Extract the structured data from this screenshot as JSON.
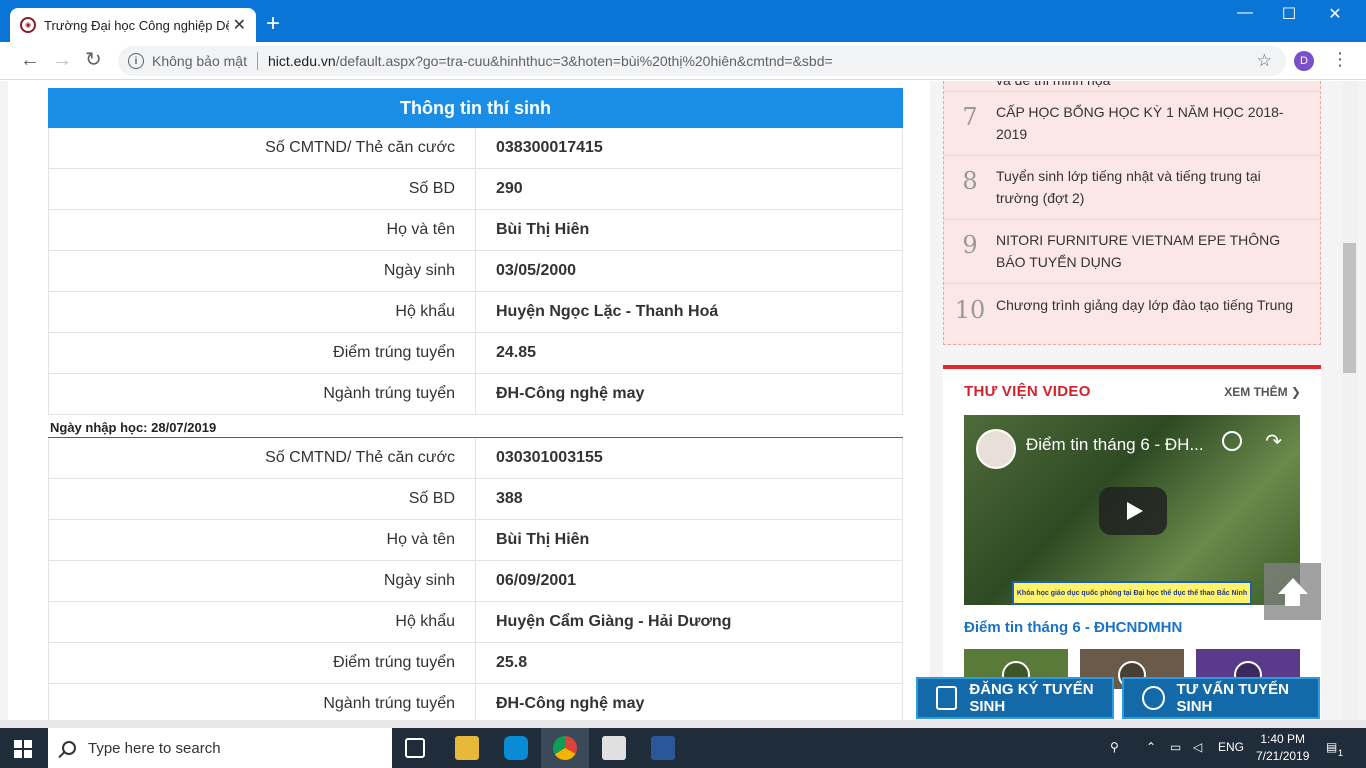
{
  "browser": {
    "tab_title": "Trường Đại học Công nghiệp Dệt",
    "tab_close": "✕",
    "new_tab": "+",
    "minimize": "—",
    "maximize": "☐",
    "close": "✕",
    "back": "←",
    "forward": "→",
    "reload": "↻",
    "security_text": "Không bảo mật",
    "url_host": "hict.edu.vn",
    "url_path": "/default.aspx?go=tra-cuu&hinhthuc=3&hoten=bùi%20thị%20hiên&cmtnd=&sbd=",
    "star": "☆",
    "avatar_letter": "D",
    "menu": "⋮"
  },
  "table": {
    "header": "Thông tin thí sinh",
    "records": [
      {
        "rows": [
          {
            "label": "Số CMTND/ Thẻ căn cước",
            "value": "038300017415"
          },
          {
            "label": "Số BD",
            "value": "290"
          },
          {
            "label": "Họ và tên",
            "value": "Bùi Thị Hiên"
          },
          {
            "label": "Ngày sinh",
            "value": "03/05/2000"
          },
          {
            "label": "Hộ khẩu",
            "value": "Huyện Ngọc Lặc - Thanh Hoá"
          },
          {
            "label": "Điểm trúng tuyển",
            "value": "24.85"
          },
          {
            "label": "Ngành trúng tuyển",
            "value": "ĐH-Công nghệ may"
          }
        ],
        "note": "Ngày nhập học: 28/07/2019"
      },
      {
        "rows": [
          {
            "label": "Số CMTND/ Thẻ căn cước",
            "value": "030301003155"
          },
          {
            "label": "Số BD",
            "value": "388"
          },
          {
            "label": "Họ và tên",
            "value": "Bùi Thị Hiên"
          },
          {
            "label": "Ngày sinh",
            "value": "06/09/2001"
          },
          {
            "label": "Hộ khẩu",
            "value": "Huyện Cẩm Giàng - Hải Dương"
          },
          {
            "label": "Điểm trúng tuyển",
            "value": "25.8"
          },
          {
            "label": "Ngành trúng tuyển",
            "value": "ĐH-Công nghệ may"
          }
        ]
      }
    ]
  },
  "news": {
    "partial_text": "và đề thi minh họa",
    "items": [
      {
        "num": "7",
        "text": "CẤP HỌC BỔNG HỌC KỲ 1 NĂM HỌC 2018-2019"
      },
      {
        "num": "8",
        "text": "Tuyển sinh lớp tiếng nhật và tiếng trung tại trường (đợt 2)"
      },
      {
        "num": "9",
        "text": "NITORI FURNITURE VIETNAM EPE THÔNG BÁO TUYỂN DỤNG"
      },
      {
        "num": "10",
        "text": "Chương trình giảng dạy lớp đào tạo tiếng Trung"
      }
    ]
  },
  "video": {
    "section_title": "THƯ VIỆN VIDEO",
    "more_label": "XEM THÊM ❯",
    "overlay_title": "Điểm tin tháng 6 - ĐH...",
    "banner_text": "Khóa học giáo dục quốc phòng tại Đại học thể dục thể thao Bắc Ninh",
    "caption": "Điểm tin tháng 6 - ĐHCNDMHN",
    "share_icon": "↷"
  },
  "cta": {
    "register": "ĐĂNG KÝ TUYỂN SINH",
    "consult": "TƯ VẤN TUYỂN SINH"
  },
  "taskbar": {
    "search_placeholder": "Type here to search",
    "language": "ENG",
    "time": "1:40 PM",
    "date": "7/21/2019",
    "notification_count": "1"
  },
  "colors": {
    "header_blue": "#1a8ee6",
    "accent_red": "#e3262a",
    "link_blue": "#1a73c5",
    "news_bg": "#fbe8e6"
  }
}
